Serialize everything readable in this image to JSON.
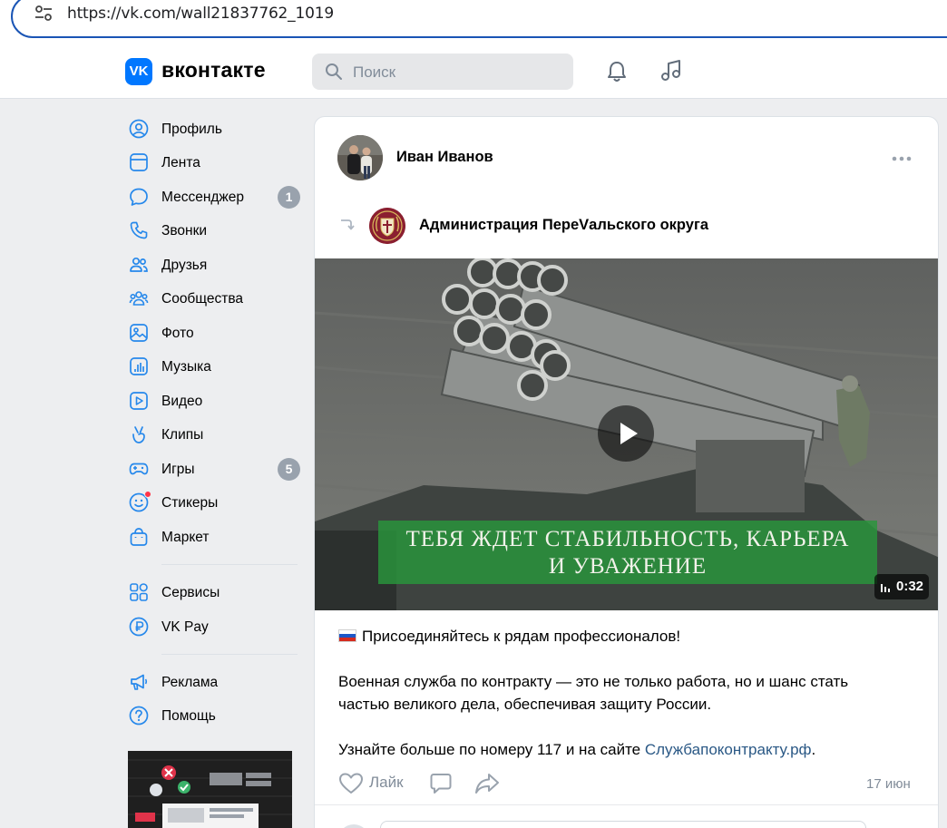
{
  "browser": {
    "url": "https://vk.com/wall21837762_1019"
  },
  "header": {
    "logo_letters": "VK",
    "wordmark": "вконтакте",
    "search_placeholder": "Поиск",
    "icons": [
      "bell-icon",
      "music-note-icon"
    ]
  },
  "sidebar": {
    "items": [
      {
        "label": "Профиль",
        "icon": "profile-icon"
      },
      {
        "label": "Лента",
        "icon": "news-feed-icon"
      },
      {
        "label": "Мессенджер",
        "icon": "message-bubble-icon",
        "badge": "1"
      },
      {
        "label": "Звонки",
        "icon": "phone-icon"
      },
      {
        "label": "Друзья",
        "icon": "friends-icon"
      },
      {
        "label": "Сообщества",
        "icon": "communities-icon"
      },
      {
        "label": "Фото",
        "icon": "photo-icon"
      },
      {
        "label": "Музыка",
        "icon": "music-icon"
      },
      {
        "label": "Видео",
        "icon": "video-icon"
      },
      {
        "label": "Клипы",
        "icon": "clips-icon"
      },
      {
        "label": "Игры",
        "icon": "gamepad-icon",
        "badge": "5"
      },
      {
        "label": "Стикеры",
        "icon": "smile-icon"
      },
      {
        "label": "Маркет",
        "icon": "shopping-bag-icon"
      },
      {
        "label": "Сервисы",
        "icon": "services-grid-icon"
      },
      {
        "label": "VK Pay",
        "icon": "ruble-coin-icon"
      },
      {
        "label": "Реклама",
        "icon": "megaphone-icon"
      },
      {
        "label": "Помощь",
        "icon": "help-icon"
      }
    ]
  },
  "post": {
    "author": "Иван Иванов",
    "repost_source": "Администрация ПереVальского округа",
    "video": {
      "caption_line1": "ТЕБЯ ЖДЕТ СТАБИЛЬНОСТЬ, КАРЬЕРА",
      "caption_line2": "И УВАЖЕНИЕ",
      "duration": "0:32"
    },
    "text": {
      "line1": "Присоединяйтесь к рядам профессионалов!",
      "line2": "Военная служба по контракту — это не только работа, но и шанс стать",
      "line3": "частью великого дела, обеспечивая защиту России.",
      "line4_before": "Узнайте больше по номеру 117 и на сайте ",
      "line4_link": "Служба­по­контракту.рф",
      "line4_after": "."
    },
    "actions": {
      "like_label": "Лайк",
      "date": "17 июн"
    }
  },
  "colors": {
    "accent": "#0077ff",
    "page_bg": "#edeef0",
    "link": "#2a5885",
    "muted": "#818c99",
    "badge": "#99a2ad",
    "caption_green": "#2c9a3f"
  }
}
